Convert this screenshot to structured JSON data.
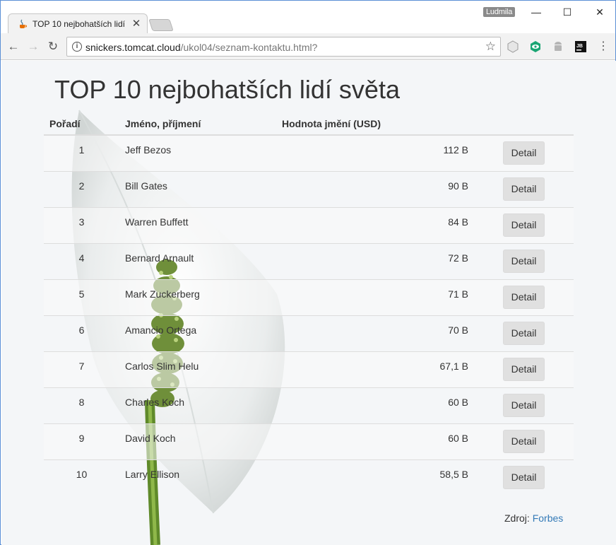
{
  "browser": {
    "tab_title": "TOP 10 nejbohatších lidí",
    "user": "Ludmila",
    "url_host": "snickers.tomcat.cloud",
    "url_path": "/ukol04/seznam-kontaktu.html?"
  },
  "page": {
    "heading": "TOP 10 nejbohatších lidí světa",
    "columns": {
      "rank": "Pořadí",
      "name": "Jméno, příjmení",
      "value": "Hodnota jmění (USD)"
    },
    "button_label": "Detail",
    "rows": [
      {
        "rank": "1",
        "name": "Jeff Bezos",
        "value": "112 B",
        "action": "Detail"
      },
      {
        "rank": "2",
        "name": "Bill Gates",
        "value": "90 B",
        "action": "Detail"
      },
      {
        "rank": "3",
        "name": "Warren Buffett",
        "value": "84 B",
        "action": "Detail"
      },
      {
        "rank": "4",
        "name": "Bernard Arnault",
        "value": "72 B",
        "action": "Detail"
      },
      {
        "rank": "5",
        "name": "Mark Zuckerberg",
        "value": "71 B",
        "action": "Detail"
      },
      {
        "rank": "6",
        "name": "Amancio Ortega",
        "value": "70 B",
        "action": "Detail"
      },
      {
        "rank": "7",
        "name": "Carlos Slim Helu",
        "value": "67,1 B",
        "action": "Detail"
      },
      {
        "rank": "8",
        "name": "Charles Koch",
        "value": "60 B",
        "action": "Detail"
      },
      {
        "rank": "9",
        "name": "David Koch",
        "value": "60 B",
        "action": "Detail"
      },
      {
        "rank": "10",
        "name": "Larry Ellison",
        "value": "58,5 B",
        "action": "Detail"
      }
    ],
    "source_label": "Zdroj:",
    "source_link": "Forbes"
  },
  "colors": {
    "link": "#337ab7",
    "page_bg": "#f4f6f8",
    "button_bg": "#e0e0e0"
  }
}
